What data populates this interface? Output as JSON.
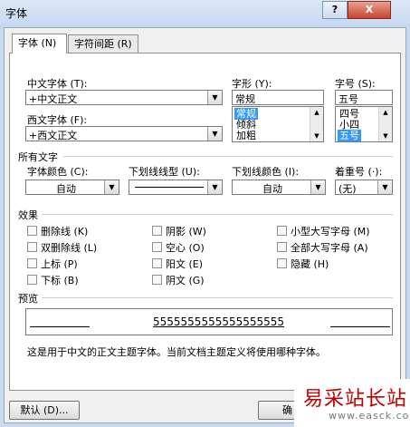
{
  "window": {
    "title": "字体",
    "help_label": "?",
    "close_label": "X"
  },
  "tabs": [
    {
      "label": "字体 (N)"
    },
    {
      "label": "字符间距 (R)"
    }
  ],
  "font": {
    "chinese_label": "中文字体 (T):",
    "chinese_value": "+中文正文",
    "western_label": "西文字体 (F):",
    "western_value": "+西文正文",
    "style_label": "字形 (Y):",
    "style_value": "常规",
    "style_options": [
      "常规",
      "倾斜",
      "加粗"
    ],
    "size_label": "字号 (S):",
    "size_value": "五号",
    "size_options": [
      "四号",
      "小四",
      "五号"
    ]
  },
  "all_text": {
    "heading": "所有文字",
    "color_label": "字体颜色 (C):",
    "color_value": "自动",
    "underline_label": "下划线线型 (U):",
    "underline_color_label": "下划线颜色 (I):",
    "underline_color_value": "自动",
    "emphasis_label": "着重号 (·):",
    "emphasis_value": "(无)"
  },
  "effects": {
    "heading": "效果",
    "col1": [
      "删除线 (K)",
      "双删除线 (L)",
      "上标 (P)",
      "下标 (B)"
    ],
    "col2": [
      "阴影 (W)",
      "空心 (O)",
      "阳文 (E)",
      "阴文 (G)"
    ],
    "col3": [
      "小型大写字母 (M)",
      "全部大写字母 (A)",
      "隐藏 (H)"
    ]
  },
  "preview": {
    "heading": "预览",
    "sample": "5555555555555555555",
    "note": "这是用于中文的正文主题字体。当前文档主题定义将使用哪种字体。"
  },
  "buttons": {
    "default": "默认 (D)...",
    "ok_partial": "确"
  },
  "watermark": {
    "name": "易采站长站",
    "url": "www.easck.com"
  }
}
